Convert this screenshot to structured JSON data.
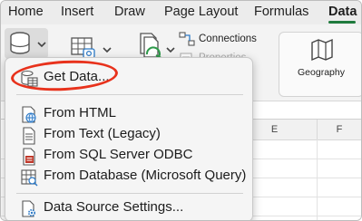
{
  "tabs": [
    "Home",
    "Insert",
    "Draw",
    "Page Layout",
    "Formulas",
    "Data"
  ],
  "active_tab": "Data",
  "ribbon": {
    "connections_label": "Connections",
    "properties_label": "Properties",
    "geography_label": "Geography"
  },
  "columns": [
    "E",
    "F"
  ],
  "menu": {
    "items": [
      {
        "label": "Get Data...",
        "icon": "database-table-icon"
      },
      {
        "label": "From HTML",
        "icon": "html-globe-icon"
      },
      {
        "label": "From Text (Legacy)",
        "icon": "text-file-icon"
      },
      {
        "label": "From SQL Server ODBC",
        "icon": "sql-file-icon"
      },
      {
        "label": "From Database (Microsoft Query)",
        "icon": "database-query-icon"
      },
      {
        "label": "Data Source Settings...",
        "icon": "data-source-settings-icon"
      }
    ]
  },
  "colors": {
    "accent": "#1f7a3d",
    "highlight": "#e8321c"
  }
}
